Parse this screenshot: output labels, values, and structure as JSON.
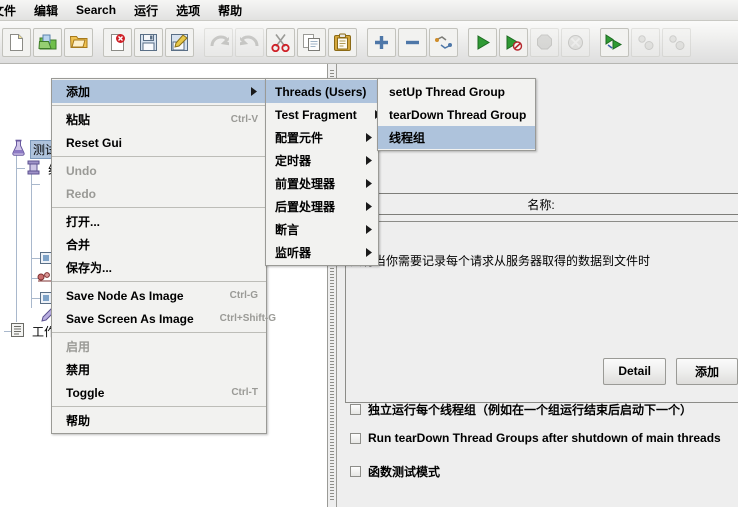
{
  "menubar": {
    "items": [
      {
        "label": "文件",
        "name": "menu-file"
      },
      {
        "label": "编辑",
        "name": "menu-edit"
      },
      {
        "label": "Search",
        "name": "menu-search"
      },
      {
        "label": "运行",
        "name": "menu-run"
      },
      {
        "label": "选项",
        "name": "menu-options"
      },
      {
        "label": "帮助",
        "name": "menu-help"
      }
    ]
  },
  "toolbar": {
    "buttons": [
      {
        "icon": "new-file-icon",
        "enabled": true
      },
      {
        "icon": "new-template-icon",
        "enabled": true
      },
      {
        "icon": "open-folder-icon",
        "enabled": true
      },
      {
        "icon": "close-icon",
        "enabled": true
      },
      {
        "icon": "save-icon",
        "enabled": true
      },
      {
        "icon": "save-as-icon",
        "enabled": true
      },
      {
        "icon": "undo-icon",
        "enabled": false
      },
      {
        "icon": "redo-icon",
        "enabled": false
      },
      {
        "icon": "cut-icon",
        "enabled": true
      },
      {
        "icon": "copy-icon",
        "enabled": true
      },
      {
        "icon": "paste-icon",
        "enabled": true
      },
      {
        "icon": "expand-all-icon",
        "enabled": true
      },
      {
        "icon": "collapse-all-icon",
        "enabled": true
      },
      {
        "icon": "toggle-icon",
        "enabled": true
      },
      {
        "icon": "start-icon",
        "enabled": true
      },
      {
        "icon": "start-no-timers-icon",
        "enabled": true
      },
      {
        "icon": "stop-icon",
        "enabled": false
      },
      {
        "icon": "shutdown-icon",
        "enabled": false
      },
      {
        "icon": "start-remote-all-icon",
        "enabled": true
      },
      {
        "icon": "stop-remote-all-icon",
        "enabled": false
      },
      {
        "icon": "shutdown-remote-all-icon",
        "enabled": false
      }
    ]
  },
  "tree": {
    "nodes": [
      {
        "label": "测试计划",
        "icon": "test-plan-icon",
        "selected": true,
        "name": "tree-node-test-plan"
      },
      {
        "label": "线",
        "icon": "thread-group-icon",
        "selected": false,
        "name": "tree-node-thread-group"
      },
      {
        "label": "工作台",
        "icon": "workbench-icon",
        "selected": false,
        "name": "tree-node-workbench"
      }
    ]
  },
  "context_menu": {
    "items": [
      {
        "label": "添加",
        "accel": "",
        "state": "highlighted",
        "submenu": true,
        "name": "ctx-add"
      },
      {
        "type": "separator"
      },
      {
        "label": "粘贴",
        "accel": "Ctrl-V",
        "state": "normal",
        "submenu": false,
        "name": "ctx-paste"
      },
      {
        "label": "Reset Gui",
        "accel": "",
        "state": "normal",
        "submenu": false,
        "name": "ctx-reset-gui"
      },
      {
        "type": "separator"
      },
      {
        "label": "Undo",
        "accel": "",
        "state": "disabled",
        "submenu": false,
        "name": "ctx-undo"
      },
      {
        "label": "Redo",
        "accel": "",
        "state": "disabled",
        "submenu": false,
        "name": "ctx-redo"
      },
      {
        "type": "separator"
      },
      {
        "label": "打开...",
        "accel": "",
        "state": "normal",
        "submenu": false,
        "name": "ctx-open"
      },
      {
        "label": "合并",
        "accel": "",
        "state": "normal",
        "submenu": false,
        "name": "ctx-merge"
      },
      {
        "label": "保存为...",
        "accel": "",
        "state": "normal",
        "submenu": false,
        "name": "ctx-save-as"
      },
      {
        "type": "separator"
      },
      {
        "label": "Save Node As Image",
        "accel": "Ctrl-G",
        "state": "normal",
        "submenu": false,
        "name": "ctx-save-node-as-image"
      },
      {
        "label": "Save Screen As Image",
        "accel": "Ctrl+Shift-G",
        "state": "normal",
        "submenu": false,
        "name": "ctx-save-screen-as-image"
      },
      {
        "type": "separator"
      },
      {
        "label": "启用",
        "accel": "",
        "state": "disabled",
        "submenu": false,
        "name": "ctx-enable"
      },
      {
        "label": "禁用",
        "accel": "",
        "state": "normal",
        "submenu": false,
        "name": "ctx-disable"
      },
      {
        "label": "Toggle",
        "accel": "Ctrl-T",
        "state": "normal",
        "submenu": false,
        "name": "ctx-toggle"
      },
      {
        "type": "separator"
      },
      {
        "label": "帮助",
        "accel": "",
        "state": "normal",
        "submenu": false,
        "name": "ctx-help"
      }
    ]
  },
  "add_submenu": {
    "items": [
      {
        "label": "Threads (Users)",
        "state": "highlighted",
        "submenu": true,
        "name": "submenu-threads-users"
      },
      {
        "label": "Test Fragment",
        "state": "normal",
        "submenu": true,
        "name": "submenu-test-fragment"
      },
      {
        "label": "配置元件",
        "state": "normal",
        "submenu": true,
        "name": "submenu-config-element"
      },
      {
        "label": "定时器",
        "state": "normal",
        "submenu": true,
        "name": "submenu-timer"
      },
      {
        "label": "前置处理器",
        "state": "normal",
        "submenu": true,
        "name": "submenu-pre-processor"
      },
      {
        "label": "后置处理器",
        "state": "normal",
        "submenu": true,
        "name": "submenu-post-processor"
      },
      {
        "label": "断言",
        "state": "normal",
        "submenu": true,
        "name": "submenu-assertion"
      },
      {
        "label": "监听器",
        "state": "normal",
        "submenu": true,
        "name": "submenu-listener"
      }
    ]
  },
  "threads_submenu": {
    "items": [
      {
        "label": "setUp Thread Group",
        "state": "normal",
        "name": "threads-setup-thread-group"
      },
      {
        "label": "tearDown Thread Group",
        "state": "normal",
        "name": "threads-teardown-thread-group"
      },
      {
        "label": "线程组",
        "state": "highlighted",
        "name": "threads-thread-group"
      }
    ]
  },
  "right_panel": {
    "name_label": "名称:",
    "buttons": [
      {
        "label": "Detail",
        "name": "detail-button"
      },
      {
        "label": "添加",
        "name": "add-button"
      }
    ],
    "checkboxes": [
      {
        "label": "独立运行每个线程组（例如在一个组运行结束后启动下一个）",
        "checked": false,
        "name": "checkbox-run-thread-groups-consecutively"
      },
      {
        "label": "Run tearDown Thread Groups after shutdown of main threads",
        "checked": false,
        "name": "checkbox-run-teardown-after-shutdown"
      },
      {
        "label": "函数测试模式",
        "checked": false,
        "name": "checkbox-functional-test-mode"
      }
    ],
    "hint": "只有当你需要记录每个请求从服务器取得的数据到文件时"
  },
  "colors": {
    "selection": "#aec3dc",
    "panel_bg": "#eeeeee",
    "tree_bg": "#ffffff",
    "disabled_text": "#9a9a96"
  }
}
